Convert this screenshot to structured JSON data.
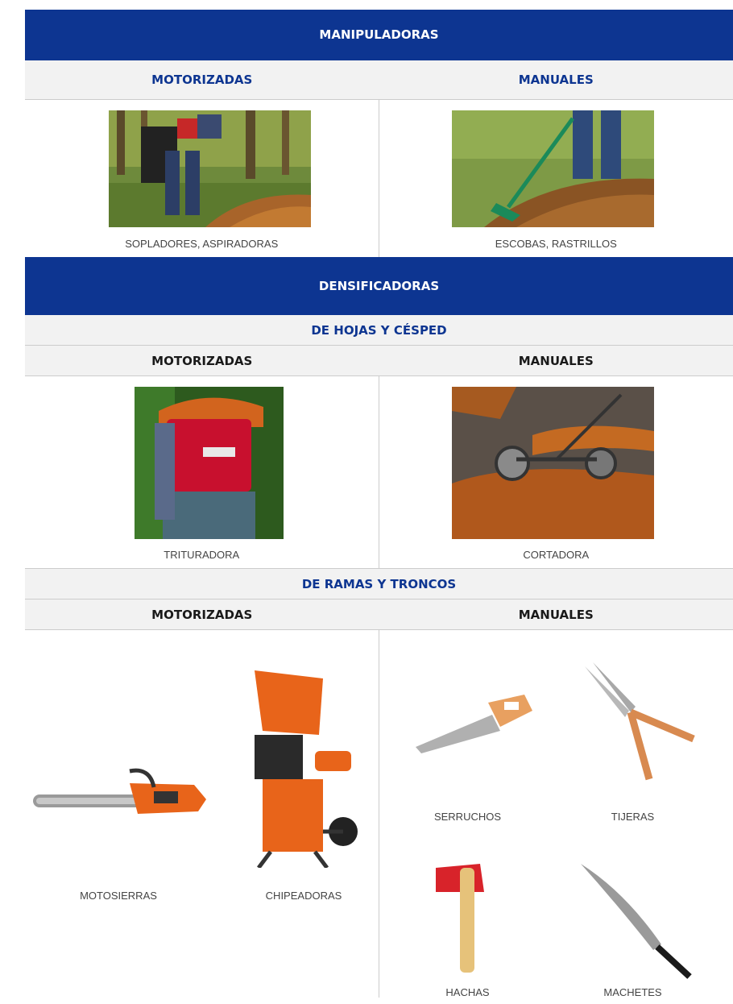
{
  "section1": {
    "title": "MANIPULADORAS",
    "left_header": "MOTORIZADAS",
    "right_header": "MANUALES",
    "left_caption": "SOPLADORES, ASPIRADORAS",
    "right_caption": "ESCOBAS, RASTRILLOS"
  },
  "section2": {
    "title": "DENSIFICADORAS",
    "sub1": {
      "title": "DE HOJAS Y CÉSPED",
      "left_header": "MOTORIZADAS",
      "right_header": "MANUALES",
      "left_caption": "TRITURADORA",
      "right_caption": "CORTADORA"
    },
    "sub2": {
      "title": "DE RAMAS Y TRONCOS",
      "left_header": "MOTORIZADAS",
      "right_header": "MANUALES",
      "left_items": [
        "MOTOSIERRAS",
        "CHIPEADORAS"
      ],
      "right_items": [
        "SERRUCHOS",
        "TIJERAS",
        "HACHAS",
        "MACHETES"
      ]
    }
  },
  "colors": {
    "band": "#0d3591",
    "bar": "#f2f2f2",
    "tool_orange": "#e8641a"
  }
}
